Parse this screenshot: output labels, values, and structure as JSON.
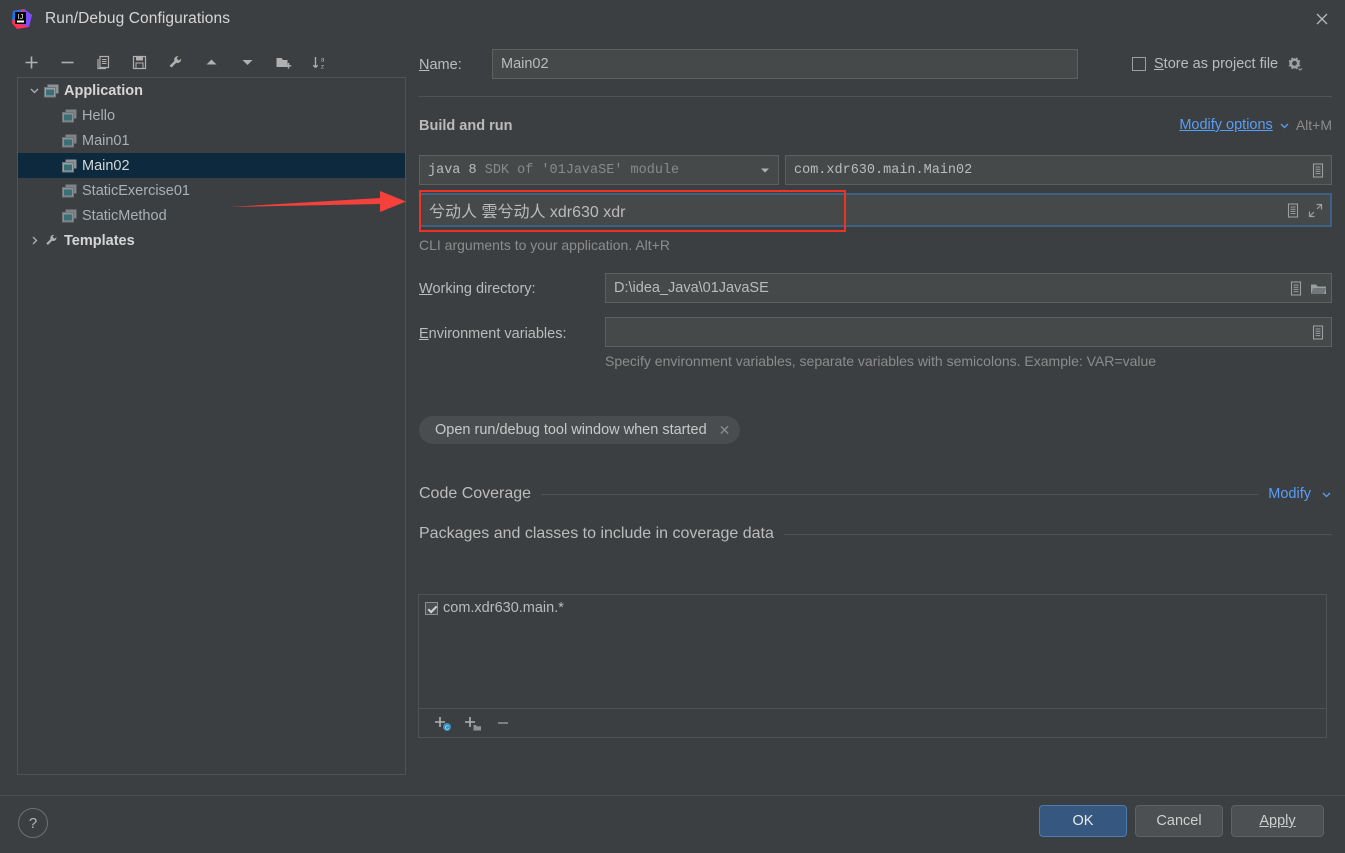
{
  "window": {
    "title": "Run/Debug Configurations",
    "app_icon": "intellij-idea-logo",
    "close_icon": "close-icon"
  },
  "tree_toolbar": {
    "buttons": [
      {
        "name": "add",
        "icon": "plus-icon",
        "label": "+"
      },
      {
        "name": "remove",
        "icon": "minus-icon",
        "label": "−"
      },
      {
        "name": "copy",
        "icon": "copy-icon",
        "label": "Copy Configuration"
      },
      {
        "name": "save",
        "icon": "save-icon",
        "label": "Save Configuration"
      },
      {
        "name": "edit-templates",
        "icon": "wrench-icon",
        "label": "Edit Templates"
      },
      {
        "name": "move-up",
        "icon": "arrow-up-icon",
        "label": "Move Up"
      },
      {
        "name": "move-down",
        "icon": "arrow-down-icon",
        "label": "Move Down"
      },
      {
        "name": "new-folder",
        "icon": "folder-add-icon",
        "label": "New Folder"
      },
      {
        "name": "sort",
        "icon": "sort-alphabetically-icon",
        "label": "Sort Configurations"
      }
    ]
  },
  "tree": {
    "items": [
      {
        "label": "Application",
        "type": "group",
        "icon": "application-icon",
        "expanded": true,
        "level": 0,
        "selected": false
      },
      {
        "label": "Hello",
        "type": "config",
        "icon": "application-icon",
        "level": 1,
        "selected": false
      },
      {
        "label": "Main01",
        "type": "config",
        "icon": "application-icon",
        "level": 1,
        "selected": false
      },
      {
        "label": "Main02",
        "type": "config",
        "icon": "application-icon",
        "level": 1,
        "selected": true
      },
      {
        "label": "StaticExercise01",
        "type": "config",
        "icon": "application-icon",
        "level": 1,
        "selected": false
      },
      {
        "label": "StaticMethod",
        "type": "config",
        "icon": "application-icon",
        "level": 1,
        "selected": false
      },
      {
        "label": "Templates",
        "type": "group",
        "icon": "wrench-icon",
        "expanded": false,
        "level": 0,
        "selected": false
      }
    ]
  },
  "annotation": {
    "arrow_color": "#f4413b",
    "highlight_color": "#ee3322"
  },
  "form": {
    "name_label": "Name:",
    "name_value": "Main02",
    "store_as_project_file_label": "Store as project file",
    "store_as_project_file_checked": false,
    "store_gear_icon": "gear-icon",
    "build_and_run_title": "Build and run",
    "modify_options_link": "Modify options",
    "modify_options_shortcut": "Alt+M",
    "jre_value_bold": "java 8",
    "jre_value_rest": "SDK of '01JavaSE' module",
    "main_class_value": "com.xdr630.main.Main02",
    "main_class_icon": "expand-list-icon",
    "program_arguments_value": "兮动人 雲兮动人 xdr630 xdr",
    "program_arguments_hint": "CLI arguments to your application. Alt+R",
    "program_arguments_icon": "expand-list-icon",
    "program_arguments_expand_icon": "expand-editor-icon",
    "working_directory_label": "Working directory:",
    "working_directory_value": "D:\\idea_Java\\01JavaSE",
    "working_directory_icon": "expand-list-icon",
    "working_directory_browse_icon": "folder-icon",
    "environment_variables_label": "Environment variables:",
    "environment_variables_value": "",
    "environment_variables_icon": "expand-list-icon",
    "environment_variables_hint": "Specify environment variables, separate variables with semicolons. Example: VAR=value",
    "chip_label": "Open run/debug tool window when started",
    "chip_remove_icon": "close-small-icon"
  },
  "coverage": {
    "section_title": "Code Coverage",
    "modify_link": "Modify",
    "sub_title": "Packages and classes to include in coverage data",
    "items": [
      {
        "label": "com.xdr630.main.*",
        "checked": true
      }
    ],
    "toolbar": [
      {
        "name": "add-class",
        "icon": "add-class-icon"
      },
      {
        "name": "add-package",
        "icon": "add-package-icon"
      },
      {
        "name": "remove-pattern",
        "icon": "minus-icon"
      }
    ]
  },
  "footer": {
    "help_label": "?",
    "ok_label": "OK",
    "cancel_label": "Cancel",
    "apply_label": "Apply",
    "ok_color": "#365880"
  }
}
